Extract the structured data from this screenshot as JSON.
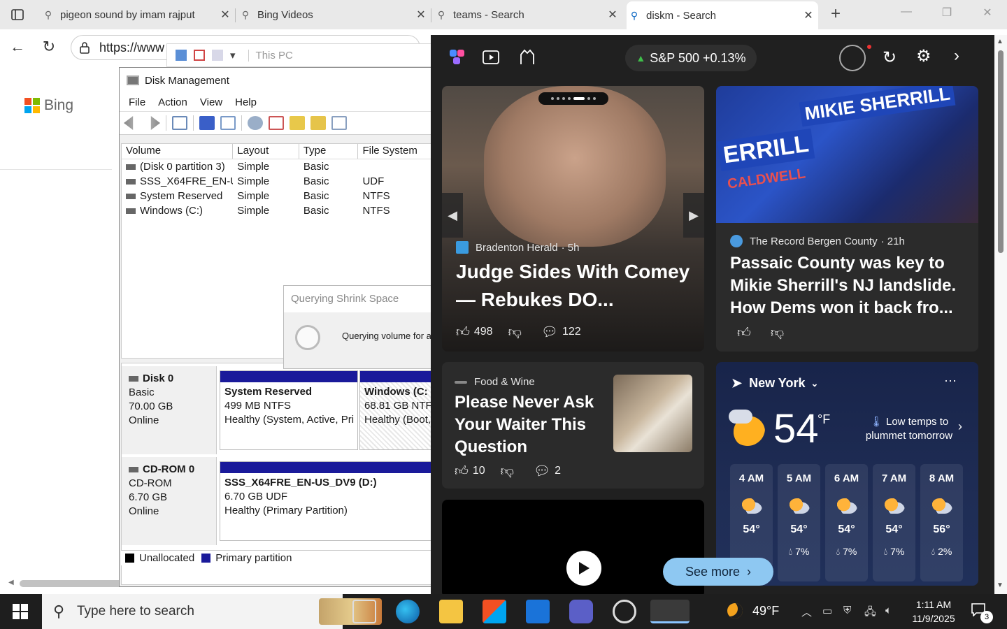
{
  "browser": {
    "tabs": [
      {
        "label": "pigeon sound by imam rajput"
      },
      {
        "label": "Bing Videos"
      },
      {
        "label": "teams - Search"
      },
      {
        "label": "diskm - Search"
      }
    ],
    "url": "https://www"
  },
  "bing": {
    "logo_text": "Bing"
  },
  "explorer": {
    "path": "This PC"
  },
  "disk_management": {
    "title": "Disk Management",
    "menu": [
      "File",
      "Action",
      "View",
      "Help"
    ],
    "columns": [
      "Volume",
      "Layout",
      "Type",
      "File System"
    ],
    "volumes": [
      {
        "volume": "(Disk 0 partition 3)",
        "layout": "Simple",
        "type": "Basic",
        "fs": ""
      },
      {
        "volume": "SSS_X64FRE_EN-U...",
        "layout": "Simple",
        "type": "Basic",
        "fs": "UDF"
      },
      {
        "volume": "System Reserved",
        "layout": "Simple",
        "type": "Basic",
        "fs": "NTFS"
      },
      {
        "volume": "Windows (C:)",
        "layout": "Simple",
        "type": "Basic",
        "fs": "NTFS"
      }
    ],
    "disk0": {
      "name": "Disk 0",
      "kind": "Basic",
      "size": "70.00 GB",
      "status": "Online",
      "p1": {
        "name": "System Reserved",
        "size": "499 MB NTFS",
        "health": "Healthy (System, Active, Pri"
      },
      "p2": {
        "name": "Windows  (C:",
        "size": "68.81 GB NTFS",
        "health": "Healthy (Boot,"
      }
    },
    "cdrom0": {
      "name": "CD-ROM 0",
      "kind": "CD-ROM",
      "size": "6.70 GB",
      "status": "Online",
      "p1": {
        "name": "SSS_X64FRE_EN-US_DV9  (D:)",
        "size": "6.70 GB UDF",
        "health": "Healthy (Primary Partition)"
      }
    },
    "legend": {
      "unallocated": "Unallocated",
      "primary": "Primary partition"
    }
  },
  "query_dialog": {
    "title": "Querying Shrink Space",
    "message": "Querying volume for a"
  },
  "widgets": {
    "stock": "S&P 500 +0.13%",
    "card1": {
      "source": "Bradenton Herald",
      "age": "· 5h",
      "headline": "Judge Sides With Comey — Rebukes DO...",
      "likes": "498",
      "comments": "122"
    },
    "card2": {
      "source": "The Record Bergen County",
      "age": "· 21h",
      "headline": "Passaic County was key to Mikie Sherrill's NJ landslide. How Dems won it back fro...",
      "sign1": "MIKIE SHERRILL",
      "sign2": "ERRILL",
      "sign3": "CALDWELL"
    },
    "card3": {
      "source": "Food & Wine",
      "headline": "Please Never Ask Your Waiter This Question",
      "likes": "10",
      "comments": "2"
    },
    "weather": {
      "city": "New York",
      "temp": "54",
      "unit": "°F",
      "note": "Low temps to plummet tomorrow",
      "hours": [
        {
          "time": "4 AM",
          "temp": "54°",
          "precip": ""
        },
        {
          "time": "5 AM",
          "temp": "54°",
          "precip": "7%"
        },
        {
          "time": "6 AM",
          "temp": "54°",
          "precip": "7%"
        },
        {
          "time": "7 AM",
          "temp": "54°",
          "precip": "7%"
        },
        {
          "time": "8 AM",
          "temp": "56°",
          "precip": "2%"
        }
      ]
    },
    "see_more": "See more"
  },
  "taskbar": {
    "search_placeholder": "Type here to search",
    "weather": "49°F",
    "time": "1:11 AM",
    "date": "11/9/2025",
    "notifications": "3"
  }
}
